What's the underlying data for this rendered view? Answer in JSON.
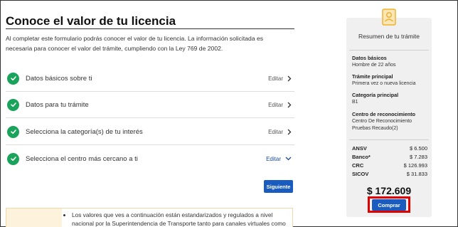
{
  "page": {
    "title": "Conoce el valor de tu licencia",
    "intro": "Al completar este formulario podrás conocer el valor de tu licencia. La información solicitada es necesaria para conocer el valor del trámite, cumpliendo con la Ley 769 de 2002."
  },
  "steps": [
    {
      "label": "Datos básicos sobre ti",
      "edit": "Editar",
      "chevron": "chevron-right-icon"
    },
    {
      "label": "Datos para tu trámite",
      "edit": "Editar",
      "chevron": "chevron-right-icon"
    },
    {
      "label": "Selecciona la categoría(s) de tu interés",
      "edit": "Editar",
      "chevron": "chevron-right-icon"
    },
    {
      "label": "Selecciona el centro más cercano a ti",
      "edit": "Editar",
      "chevron": "chevron-down-icon"
    }
  ],
  "next_button": "Siguiente",
  "note": "Los valores que ves a continuación están estandarizados y regulados a nivel nacional por la Superintendencia de Transporte tanto para canales virtuales como",
  "summary": {
    "title": "Resumen de tu trámite",
    "sections": [
      {
        "label": "Datos básicos",
        "value": "Hombre de 22 años"
      },
      {
        "label": "Trámite principal",
        "value": "Primera vez o nueva licencia"
      },
      {
        "label": "Categoría principal",
        "value": "B1"
      },
      {
        "label": "Centro de reconocimiento",
        "value": "Centro De Reconocimiento Pruebas Recaudo(2)"
      }
    ],
    "fees": [
      {
        "name": "ANSV",
        "value": "$ 6.500"
      },
      {
        "name": "Banco*",
        "value": "$ 7.283"
      },
      {
        "name": "CRC",
        "value": "$ 126.993"
      },
      {
        "name": "SICOV",
        "value": "$ 31.833"
      }
    ],
    "total": "$ 172.609",
    "buy_button": "Comprar"
  },
  "colors": {
    "accent": "#1a5bbf",
    "check": "#1aa35a",
    "highlight": "#e00000",
    "icon": "#f2b02e"
  }
}
